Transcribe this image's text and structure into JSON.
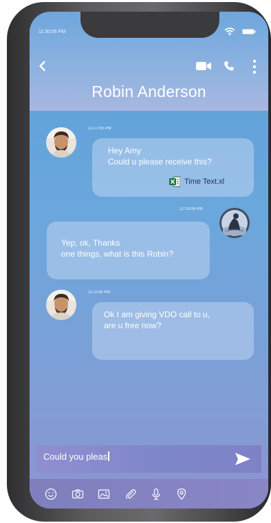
{
  "status_bar": {
    "time": "11:30:05 PM"
  },
  "header": {
    "contact_name": "Robin Anderson"
  },
  "messages": [
    {
      "sender": "contact",
      "time": "11:17:05 PM",
      "lines": [
        "Hey Amy",
        "Could u please receive this?"
      ],
      "attachment": {
        "name": "Time Text.xl",
        "icon": "excel-file-icon"
      }
    },
    {
      "sender": "me",
      "time": "11:19:06 PM",
      "lines": [
        "Yep, ok, Thanks",
        "one things, what is this Robin?"
      ]
    },
    {
      "sender": "contact",
      "time": "11:2106 PM",
      "lines": [
        "Ok I am giving VDO call to u,",
        "are u free now?"
      ]
    }
  ],
  "composer": {
    "value": "Could you pleas"
  },
  "toolbar": {
    "icons": [
      "emoji-icon",
      "camera-icon",
      "image-icon",
      "attachment-icon",
      "microphone-icon",
      "location-icon"
    ]
  },
  "colors": {
    "screen_top": "#5aa0d8",
    "screen_bottom": "#8d93cf",
    "bubble": "#bed4f0",
    "phone_frame": "#4a4a4d"
  }
}
